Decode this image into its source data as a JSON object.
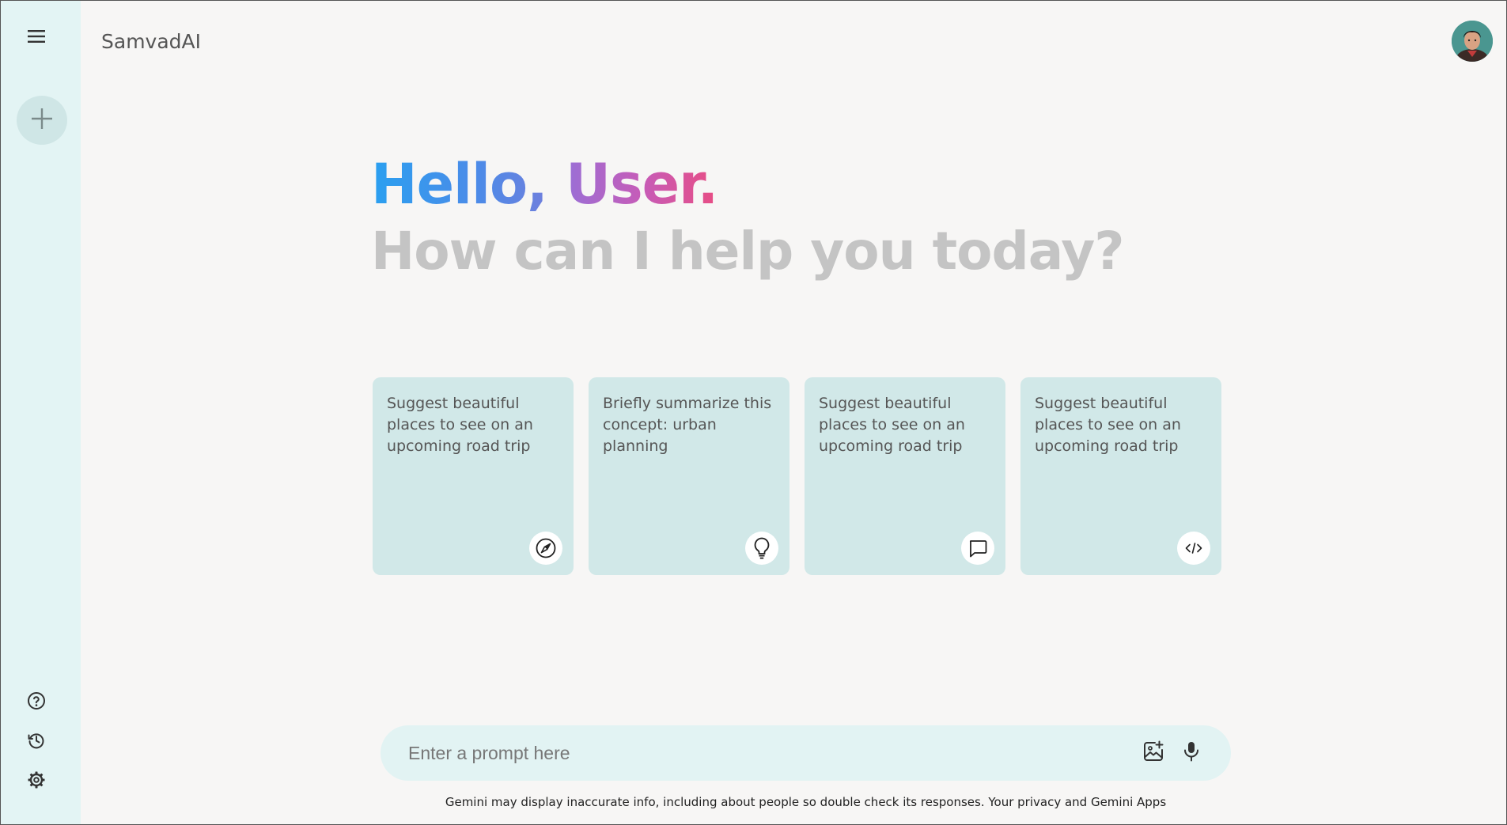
{
  "header": {
    "app_title": "SamvadAI"
  },
  "sidebar": {
    "menu_icon": "hamburger-menu-icon",
    "new_chat_icon": "plus-icon",
    "bottom_items": [
      {
        "icon": "help-icon"
      },
      {
        "icon": "history-icon"
      },
      {
        "icon": "settings-gear-icon"
      }
    ]
  },
  "greeting": {
    "hello": "Hello,",
    "user": "User.",
    "subtitle": "How can I help you today?"
  },
  "cards": [
    {
      "text": "Suggest beautiful places to see on an upcoming road trip",
      "icon": "compass-icon"
    },
    {
      "text": "Briefly summarize this concept: urban planning",
      "icon": "lightbulb-icon"
    },
    {
      "text": "Suggest beautiful places to see on an upcoming road trip",
      "icon": "chat-bubble-icon"
    },
    {
      "text": "Suggest beautiful places to see on an upcoming road trip",
      "icon": "code-icon"
    }
  ],
  "prompt": {
    "placeholder": "Enter a prompt here",
    "value": ""
  },
  "disclaimer": "Gemini may display inaccurate info, including about people so double check its responses. Your privacy and Gemini Apps",
  "colors": {
    "sidebar_bg": "#e3f4f4",
    "card_bg": "#d1e8e8",
    "page_bg": "#f7f6f5",
    "prompt_bg": "#e2f3f3"
  }
}
